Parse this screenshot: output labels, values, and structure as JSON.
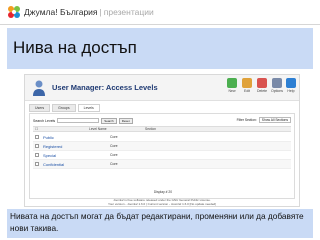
{
  "header": {
    "brand": "Джумла! България",
    "separator": "|",
    "section": "презентации"
  },
  "slide": {
    "title": "Нива на достъп",
    "caption": "Нивата на достъп могат да бъдат редактирани, променяни или да добавяте нови такива."
  },
  "screenshot": {
    "manager_title": "User Manager: Access Levels",
    "toolbar": [
      {
        "label": "New",
        "icon": "new-icon",
        "color": "#4caf50"
      },
      {
        "label": "Edit",
        "icon": "edit-icon",
        "color": "#e0a23a"
      },
      {
        "label": "Delete",
        "icon": "delete-icon",
        "color": "#d9534f"
      },
      {
        "label": "Options",
        "icon": "options-icon",
        "color": "#7a8aa8"
      },
      {
        "label": "Help",
        "icon": "help-icon",
        "color": "#2d7fd3"
      }
    ],
    "subtabs": [
      "Users",
      "Groups",
      "Levels"
    ],
    "search_label": "Search Levels",
    "search_button": "Search",
    "reset_button": "Reset",
    "filter_label": "Filter Section:",
    "filter_value": "Show All Sections",
    "columns": [
      "Level Name",
      "Section"
    ],
    "rows": [
      {
        "name": "Public",
        "section": "Core"
      },
      {
        "name": "Registered",
        "section": "Core"
      },
      {
        "name": "Special",
        "section": "Core"
      },
      {
        "name": "Confidential",
        "section": "Core"
      }
    ],
    "pager": "Display # 20",
    "footer_line1": "Joomla! is free software released under the GNU General Public License.",
    "footer_line2": "Your version - Joomla! 1.6.0 | Current version - Joomla! 1.6.0 [No update needed]"
  },
  "colors": {
    "title_band": "#c9daf5",
    "caption_band": "#c9daf5",
    "manager_title": "#1f3a73",
    "link": "#1a4fa5"
  }
}
